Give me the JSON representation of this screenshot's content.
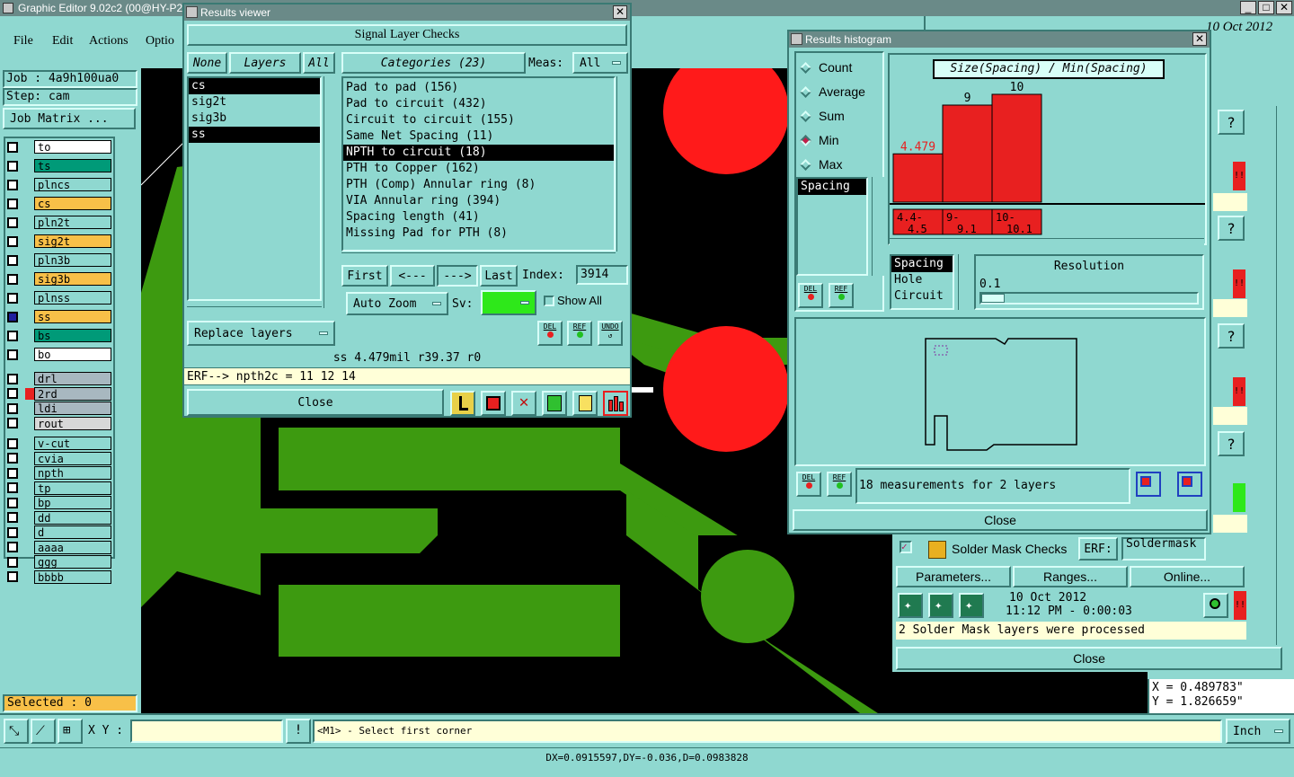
{
  "main_window": {
    "title": "Graphic Editor 9.02c2 (00@HY-P2",
    "menu": [
      "File",
      "Edit",
      "Actions",
      "Optio"
    ]
  },
  "job_panel": {
    "job": "Job : 4a9h100ua0",
    "step": "Step: cam",
    "job_matrix_label": "Job Matrix ..."
  },
  "layers": [
    {
      "name": "to",
      "color": "#ffffff"
    },
    {
      "name": "ts",
      "color": "#009a78"
    },
    {
      "name": "plncs",
      "color": "#8fd8d0"
    },
    {
      "name": "cs",
      "color": "#f8c048"
    },
    {
      "name": "pln2t",
      "color": "#8fd8d0"
    },
    {
      "name": "sig2t",
      "color": "#f8c048"
    },
    {
      "name": "pln3b",
      "color": "#8fd8d0"
    },
    {
      "name": "sig3b",
      "color": "#f8c048"
    },
    {
      "name": "plnss",
      "color": "#8fd8d0"
    },
    {
      "name": "ss",
      "color": "#f8c048"
    },
    {
      "name": "bs",
      "color": "#009a78"
    },
    {
      "name": "bo",
      "color": "#ffffff"
    },
    {
      "name": "drl",
      "color": "#a8b8c0"
    },
    {
      "name": "2rd",
      "color": "#a8b8c0"
    },
    {
      "name": "ldi",
      "color": "#a8b8c0"
    },
    {
      "name": "rout",
      "color": "#d8d8d8"
    },
    {
      "name": "v-cut",
      "color": "#8fd8d0"
    },
    {
      "name": "cvia",
      "color": "#8fd8d0"
    },
    {
      "name": "npth",
      "color": "#8fd8d0"
    },
    {
      "name": "tp",
      "color": "#8fd8d0"
    },
    {
      "name": "bp",
      "color": "#8fd8d0"
    },
    {
      "name": "dd",
      "color": "#8fd8d0"
    },
    {
      "name": "d",
      "color": "#8fd8d0"
    },
    {
      "name": "aaaa",
      "color": "#8fd8d0"
    },
    {
      "name": "ggg",
      "color": "#8fd8d0"
    },
    {
      "name": "bbbb",
      "color": "#8fd8d0"
    }
  ],
  "selected_text": "Selected : 0",
  "results_viewer": {
    "title": "Results viewer",
    "heading": "Signal Layer Checks",
    "none_label": "None",
    "layers_label": "Layers",
    "all_label": "All",
    "categories_label": "Categories (23)",
    "meas_label": "Meas:",
    "meas_value": "All",
    "layer_list": [
      "cs",
      "sig2t",
      "sig3b",
      "ss"
    ],
    "categories": [
      "Pad to pad (156)",
      "Pad to circuit (432)",
      "Circuit to circuit (155)",
      "Same Net Spacing (11)",
      "NPTH to circuit (18)",
      "PTH to Copper (162)",
      "PTH (Comp) Annular ring (8)",
      "VIA Annular ring (394)",
      "Spacing length (41)",
      "Missing Pad for PTH (8)"
    ],
    "first_label": "First",
    "prev_label": "<---",
    "next_label": "--->",
    "last_label": "Last",
    "index_label": "Index:",
    "index_value": "3914",
    "replace_layers_label": "Replace layers",
    "auto_zoom_label": "Auto Zoom",
    "sv_label": "Sv:",
    "show_all_label": "Show All",
    "del_label": "DEL",
    "ref_label": "REF",
    "undo_label": "UNDO",
    "status": "ss 4.479mil  r39.37  r0",
    "erf_line": "ERF--> npth2c = 11 12 14",
    "close_label": "Close"
  },
  "histogram": {
    "title": "Results histogram",
    "radios": [
      {
        "label": "Count",
        "checked": false
      },
      {
        "label": "Average",
        "checked": false
      },
      {
        "label": "Sum",
        "checked": false
      },
      {
        "label": "Min",
        "checked": true
      },
      {
        "label": "Max",
        "checked": false
      }
    ],
    "list": [
      "Spacing"
    ],
    "chart_title": "Size(Spacing) / Min(Spacing)",
    "bars": [
      {
        "range": "4.4- 4.5",
        "value": 4.479,
        "label": "4.479"
      },
      {
        "range": "9- 9.1",
        "value": 9,
        "label": "9"
      },
      {
        "range": "10- 10.1",
        "value": 10,
        "label": "10"
      }
    ],
    "bar_max": 10,
    "type_list": [
      "Spacing",
      "Hole",
      "Circuit"
    ],
    "resolution_label": "Resolution",
    "resolution_value": "0.1",
    "measurements_text": "18 measurements for 2 layers",
    "close_label": "Close"
  },
  "right_panel": {
    "date_fragment": "10 Oct 2012",
    "sm_title": "Solder Mask Checks",
    "erf_label": "ERF:",
    "erf_value": "Soldermask",
    "parameters_label": "Parameters...",
    "ranges_label": "Ranges...",
    "online_label": "Online...",
    "run_date": "10 Oct 2012",
    "run_time": "11:12 PM - 0:00:03",
    "message": "2 Solder Mask layers were processed",
    "close_label": "Close",
    "help_label": "?",
    "alert_label": "!!"
  },
  "coords": {
    "x": "X = 0.489783\"",
    "y": "Y = 1.826659\""
  },
  "bottom_bar": {
    "xy_label": "X Y :",
    "prompt": "<M1> - Select first corner",
    "unit": "Inch"
  },
  "status_line": "DX=0.0915597,DY=-0.036,D=0.0983828"
}
